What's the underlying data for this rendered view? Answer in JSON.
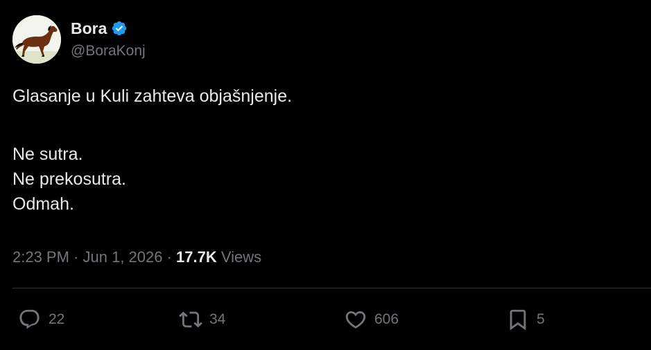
{
  "author": {
    "display_name": "Bora",
    "handle": "@BoraKonj",
    "verified": true,
    "verified_color": "#1d9bf0",
    "avatar_icon": "horse-avatar"
  },
  "tweet": {
    "lines": [
      "Glasanje u Kuli zahteva objašnjenje.",
      "",
      "Ne sutra.",
      "Ne prekosutra.",
      "Odmah."
    ]
  },
  "meta": {
    "time": "2:23 PM",
    "separator1": " · ",
    "date": "Jun 1, 2026",
    "separator2": " · ",
    "views_count": "17.7K",
    "views_label": " Views"
  },
  "actions": {
    "reply": {
      "icon": "reply-icon",
      "count": "22"
    },
    "retweet": {
      "icon": "retweet-icon",
      "count": "34"
    },
    "like": {
      "icon": "heart-icon",
      "count": "606"
    },
    "bookmark": {
      "icon": "bookmark-icon",
      "count": "5"
    }
  },
  "colors": {
    "background": "#000000",
    "text_primary": "#e7e9ea",
    "text_secondary": "#71767b",
    "divider": "#2f3336"
  }
}
